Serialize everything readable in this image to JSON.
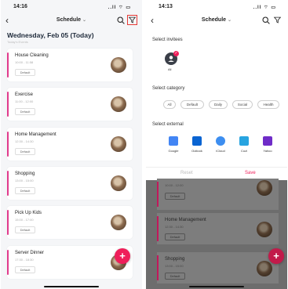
{
  "left_phone": {
    "status": {
      "time": "14:16",
      "signal": "..ll ⌔ ▭"
    },
    "nav": {
      "back": "‹",
      "title": "Schedule",
      "chevron": "⌄"
    },
    "date_heading": "Wednesday, Feb 05 (Today)",
    "date_sub": "Today's Events",
    "events": [
      {
        "title": "House Cleaning",
        "time": "10:00 - 11:58",
        "tag": "Default"
      },
      {
        "title": "Exercise",
        "time": "11:00 - 12:00",
        "tag": "Default"
      },
      {
        "title": "Home Management",
        "time": "12:30 - 14:30",
        "tag": "Default"
      },
      {
        "title": "Shopping",
        "time": "13:00 - 15:00",
        "tag": "Default"
      },
      {
        "title": "Pick Up Kids",
        "time": "15:00 - 17:00",
        "tag": "Default"
      },
      {
        "title": "Server Dinner",
        "time": "17:30 - 18:30",
        "tag": "Default"
      }
    ],
    "fab_label": "+"
  },
  "right_phone": {
    "status": {
      "time": "14:13",
      "signal": "..ll ⌔ ▭"
    },
    "nav": {
      "back": "‹",
      "title": "Schedule",
      "chevron": "⌄"
    },
    "select_invitees": "Select invitees",
    "invitee_label": "All",
    "select_category": "Select category",
    "categories": [
      "All",
      "Default",
      "Daily",
      "Social",
      "Health"
    ],
    "select_external": "Select external",
    "externals": [
      {
        "label": "Google",
        "color": "#4285f4"
      },
      {
        "label": "Outlook",
        "color": "#0a64d2"
      },
      {
        "label": "iCloud",
        "color": "#3d8ef0"
      },
      {
        "label": "Cozi",
        "color": "#28a4e0"
      },
      {
        "label": "Yahoo",
        "color": "#6f2cc8"
      }
    ],
    "reset_label": "Reset",
    "save_label": "Save",
    "dim_events": [
      {
        "title": "",
        "time": "10:00 - 12:00",
        "tag": "Default"
      },
      {
        "title": "Home Management",
        "time": "12:30 - 14:30",
        "tag": "Default"
      },
      {
        "title": "Shopping",
        "time": "13:00 - 15:00",
        "tag": "Default"
      }
    ],
    "fab_label": "+"
  },
  "colors": {
    "accent": "#ef1e5a",
    "event_bar": "#e23a8c"
  }
}
